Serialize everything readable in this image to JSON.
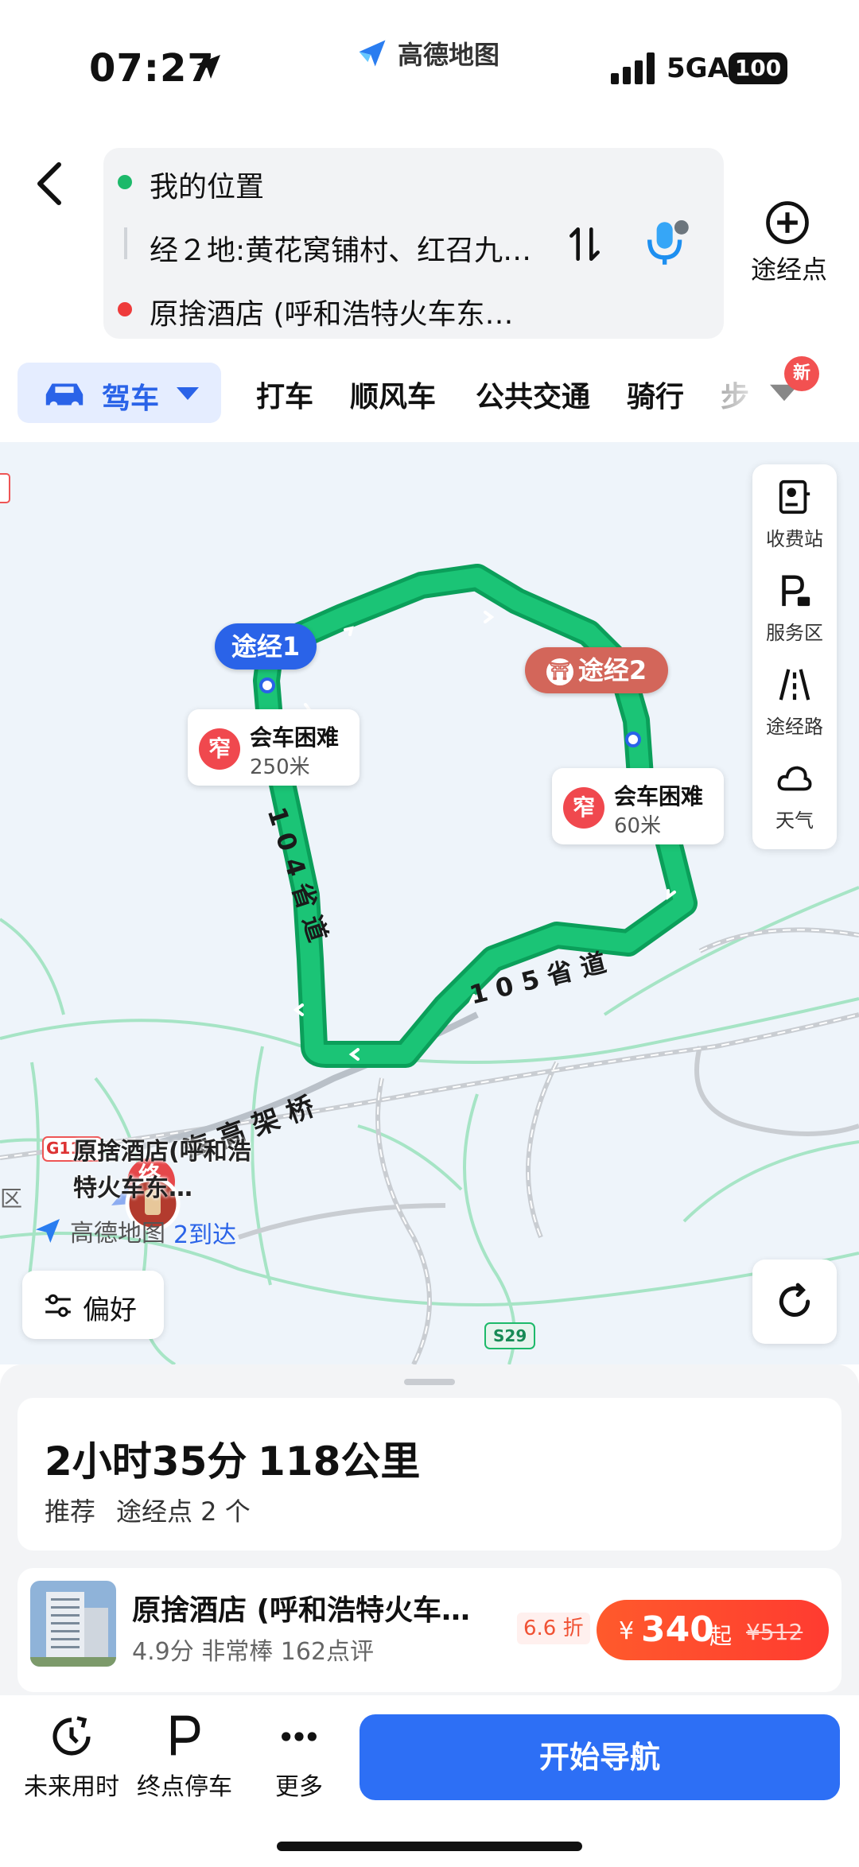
{
  "status_bar": {
    "time": "07:27",
    "app_name": "高德地图",
    "network": "5GA",
    "battery": "100"
  },
  "route": {
    "origin": "我的位置",
    "waypoints": "经２地:黄花窝铺村、红召九…",
    "destination": "原捨酒店 (呼和浩特火车东…",
    "add_via_label": "途经点"
  },
  "modes": {
    "active": "驾车",
    "items": [
      "打车",
      "顺风车",
      "公共交通",
      "骑行",
      "步"
    ],
    "new_badge": "新"
  },
  "map": {
    "tools": [
      {
        "label": "收费站",
        "icon": "toll-station-icon"
      },
      {
        "label": "服务区",
        "icon": "service-area-icon"
      },
      {
        "label": "途经路",
        "icon": "via-road-icon"
      },
      {
        "label": "天气",
        "icon": "weather-icon"
      }
    ],
    "via1": "途经1",
    "via2": "途经2",
    "warnings": [
      {
        "icon_text": "窄",
        "title": "会车困难",
        "distance": "250米"
      },
      {
        "icon_text": "窄",
        "title": "会车困难",
        "distance": "60米"
      }
    ],
    "road_labels": {
      "r104": "1 0 4 省 道",
      "r105": "1 0 5 省 道",
      "viaduct": "海 高 架 桥",
      "g110": "G110",
      "s29": "S29",
      "district": "区"
    },
    "dest_marker_text": "终",
    "dest_label": "原捨酒店(呼和浩特火车东…",
    "logo_text": "高德地图",
    "arrive_text": "2到达",
    "pref_label": "偏好",
    "route_color": "#1bb36b"
  },
  "summary": {
    "duration": "2小时35分",
    "distance": "118公里",
    "tag": "推荐",
    "via_count": "途经点 2 个"
  },
  "hotel": {
    "name": "原捨酒店 (呼和浩特火车…",
    "meta": "4.9分 非常棒 162点评",
    "discount": "6.6 折",
    "currency": "¥",
    "price": "340",
    "qi": "起",
    "old_price": "¥512"
  },
  "bottom": {
    "future": "未来用时",
    "parking": "终点停车",
    "more": "更多",
    "start_nav": "开始导航"
  }
}
